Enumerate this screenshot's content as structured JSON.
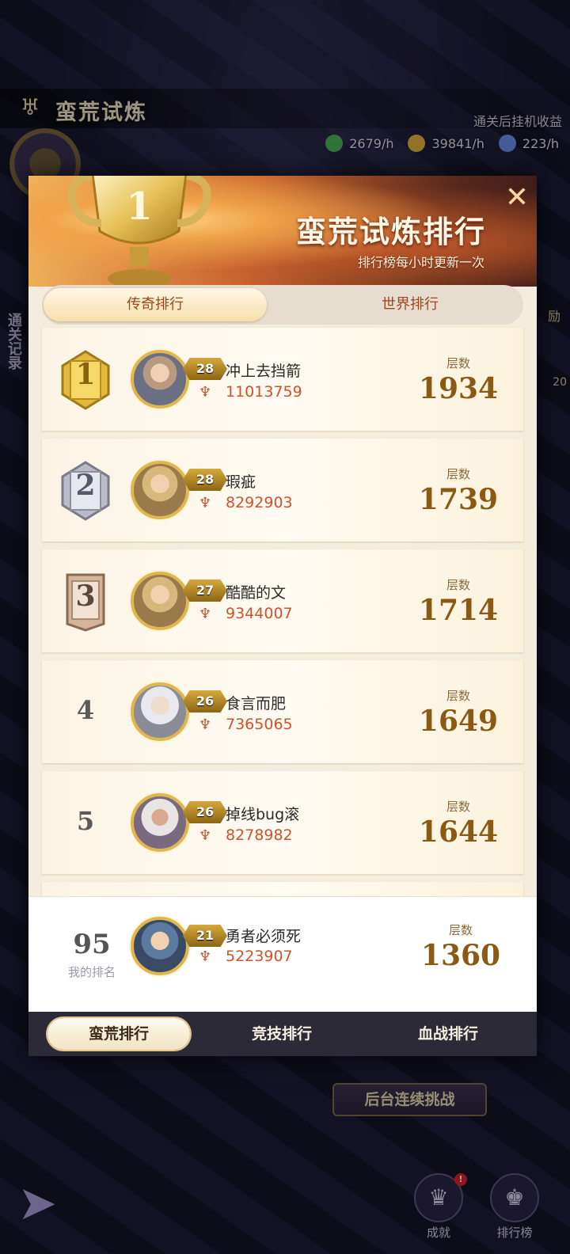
{
  "header": {
    "mode_title": "蛮荒试炼",
    "idle_label": "通关后挂机收益",
    "resources": [
      {
        "value": "2679/h",
        "icon": "green-leaf-icon",
        "color": "#4bb35a"
      },
      {
        "value": "39841/h",
        "icon": "gold-coin-icon",
        "color": "#e0b13c"
      },
      {
        "value": "223/h",
        "icon": "blue-crystal-icon",
        "color": "#6c8ee8"
      }
    ]
  },
  "side": {
    "records_label": "通关记录",
    "right_peek": "励",
    "right_peek_2": "20"
  },
  "background_buttons": {
    "continuous_challenge": "后台连续挑战",
    "achievements": "成就",
    "leaderboard": "排行榜",
    "notification_badge": "!"
  },
  "modal": {
    "title": "蛮荒试炼排行",
    "subtitle": "排行榜每小时更新一次",
    "close_glyph": "✕",
    "tabs": [
      {
        "label": "传奇排行",
        "active": true
      },
      {
        "label": "世界排行",
        "active": false
      }
    ],
    "floor_label": "层数",
    "rows": [
      {
        "rank": "1",
        "level": "28",
        "name": "冲上去挡箭",
        "power": "11013759",
        "floor": "1934",
        "badge_color": "#e2b93c"
      },
      {
        "rank": "2",
        "level": "28",
        "name": "瑕疵",
        "power": "8292903",
        "floor": "1739",
        "badge_color": "#b9bcc8"
      },
      {
        "rank": "3",
        "level": "27",
        "name": "酷酷的文",
        "power": "9344007",
        "floor": "1714",
        "badge_color": "#d2b49a"
      },
      {
        "rank": "4",
        "level": "26",
        "name": "食言而肥",
        "power": "7365065",
        "floor": "1649",
        "badge_color": ""
      },
      {
        "rank": "5",
        "level": "26",
        "name": "掉线bug滚",
        "power": "8278982",
        "floor": "1644",
        "badge_color": ""
      }
    ],
    "my_row": {
      "rank": "95",
      "rank_label": "我的排名",
      "level": "21",
      "name": "勇者必须死",
      "power": "5223907",
      "floor_label": "层数",
      "floor": "1360"
    },
    "bottom_tabs": [
      {
        "label": "蛮荒排行",
        "active": true
      },
      {
        "label": "竞技排行",
        "active": false
      },
      {
        "label": "血战排行",
        "active": false
      }
    ]
  }
}
